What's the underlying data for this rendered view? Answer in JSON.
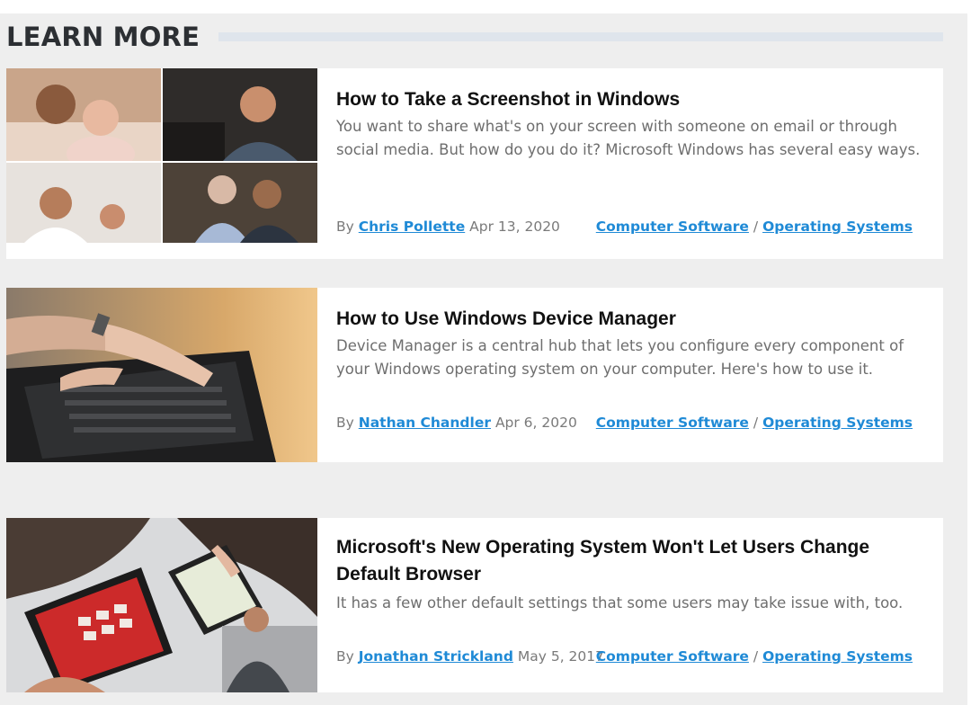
{
  "section": {
    "heading": "LEARN MORE"
  },
  "articles": [
    {
      "title": "How to Take a Screenshot in Windows",
      "description": "You want to share what's on your screen with someone on email or through social media. But how do you do it? Microsoft Windows has several easy ways.",
      "by": "By",
      "author": "Chris Pollette",
      "date": "Apr 13, 2020",
      "category1": "Computer Software",
      "separator": "/",
      "category2": "Operating Systems"
    },
    {
      "title": "How to Use Windows Device Manager",
      "description": "Device Manager is a central hub that lets you configure every component of your Windows operating system on your computer. Here's how to use it.",
      "by": "By",
      "author": "Nathan Chandler",
      "date": "Apr 6, 2020",
      "category1": "Computer Software",
      "separator": "/",
      "category2": "Operating Systems"
    },
    {
      "title": "Microsoft's New Operating System Won't Let Users Change Default Browser",
      "description": "It has a few other default settings that some users may take issue with, too.",
      "by": "By",
      "author": "Jonathan Strickland",
      "date": "May 5, 2017",
      "category1": "Computer Software",
      "separator": "/",
      "category2": "Operating Systems"
    }
  ],
  "colors": {
    "link": "#1f8ad6",
    "panel": "#eeeeee",
    "card": "#ffffff",
    "rule": "#dfe5ec"
  }
}
